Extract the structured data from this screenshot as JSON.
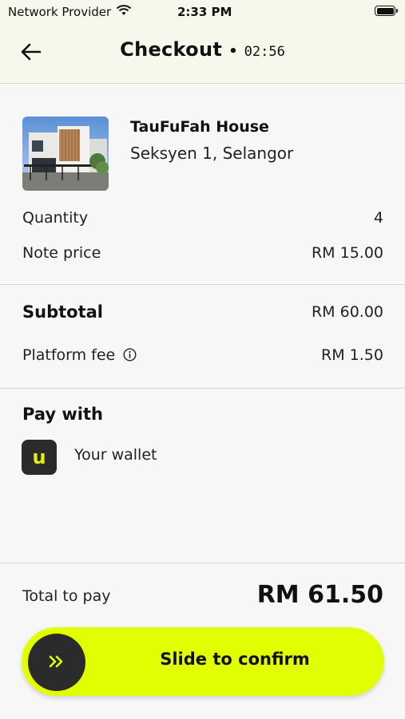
{
  "status_bar": {
    "carrier": "Network Provider",
    "time": "2:33 PM",
    "wifi_icon": "wifi-icon",
    "battery_icon": "battery-icon"
  },
  "header": {
    "back_icon": "arrow-left-icon",
    "title": "Checkout",
    "separator": "•",
    "timer": "02:56"
  },
  "property": {
    "image_icon": "house-photo",
    "name": "TauFuFah House",
    "location": "Seksyen 1, Selangor"
  },
  "details": {
    "quantity_label": "Quantity",
    "quantity_value": "4",
    "note_price_label": "Note price",
    "note_price_value": "RM 15.00"
  },
  "fees": {
    "subtotal_label": "Subtotal",
    "subtotal_value": "RM 60.00",
    "platform_fee_label": "Platform fee",
    "platform_fee_icon": "info-icon",
    "platform_fee_value": "RM 1.50"
  },
  "payment": {
    "title": "Pay with",
    "wallet_logo_letter": "u",
    "wallet_label": "Your wallet"
  },
  "footer": {
    "total_label": "Total to pay",
    "total_value": "RM 61.50",
    "slider_icon": "double-chevron-right-icon",
    "slider_label": "Slide to confirm"
  },
  "colors": {
    "accent": "#e2ff00",
    "header_bg": "#f7f8ec",
    "page_bg": "#f7f7f7",
    "dark": "#2b2b2b"
  }
}
